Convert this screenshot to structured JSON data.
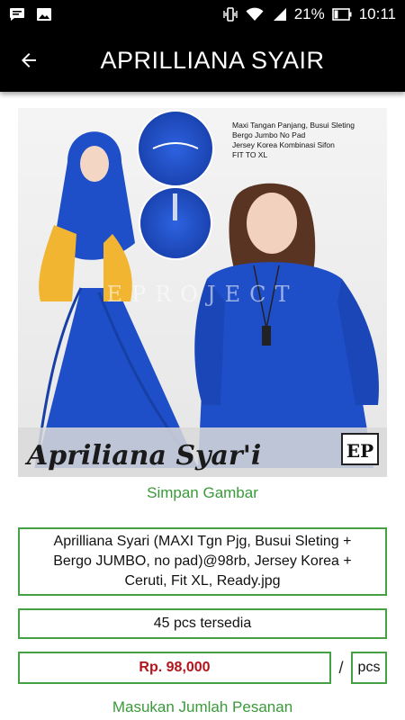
{
  "status_bar": {
    "battery_percent": "21%",
    "time": "10:11",
    "icons": [
      "message-icon",
      "image-icon",
      "vibrate-icon",
      "wifi-icon",
      "signal-icon",
      "battery-icon"
    ]
  },
  "app_bar": {
    "title": "APRILLIANA SYAIR",
    "back_icon": "back-arrow-icon"
  },
  "product_image": {
    "caption": "Apriliana Syar'i",
    "info_text": [
      "Maxi Tangan Panjang, Busui Sleting",
      "Bergo Jumbo No Pad",
      "Jersey Korea Kombinasi Sifon",
      "FIT TO XL"
    ],
    "watermark": "EPROJECT",
    "logo": "EP",
    "colors": {
      "dress": "#1e4fc8",
      "accent": "#f2b531"
    }
  },
  "save_image_label": "Simpan Gambar",
  "description": "Aprilliana Syari (MAXI Tgn Pjg, Busui Sleting + Bergo JUMBO, no pad)@98rb, Jersey Korea + Ceruti, Fit XL, Ready.jpg",
  "stock": "45 pcs tersedia",
  "price": "Rp. 98,000",
  "price_separator": "/",
  "unit": "pcs",
  "order_label": "Masukan Jumlah Pesanan",
  "colors": {
    "accent_green": "#44a244",
    "price_red": "#b3141b"
  }
}
